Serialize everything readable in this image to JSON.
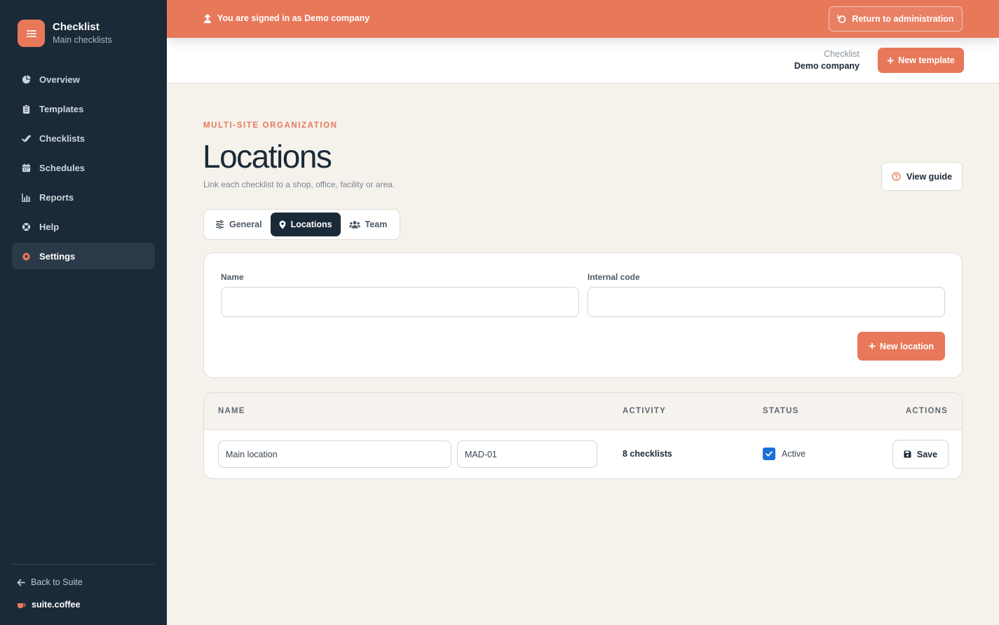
{
  "sidebar": {
    "brand_title": "Checklist",
    "brand_subtitle": "Main checklists",
    "items": [
      {
        "label": "Overview",
        "icon": "pie-chart-icon"
      },
      {
        "label": "Templates",
        "icon": "clipboard-icon"
      },
      {
        "label": "Checklists",
        "icon": "double-check-icon"
      },
      {
        "label": "Schedules",
        "icon": "calendar-icon"
      },
      {
        "label": "Reports",
        "icon": "bar-chart-icon"
      },
      {
        "label": "Help",
        "icon": "lifebuoy-icon"
      },
      {
        "label": "Settings",
        "icon": "gear-icon",
        "active": true
      }
    ],
    "back_label": "Back to Suite",
    "suite_brand": "suite.coffee"
  },
  "banner": {
    "message": "You are signed in as Demo company",
    "return_label": "Return to administration"
  },
  "topbar": {
    "company_label": "Checklist",
    "company_name": "Demo company",
    "new_template_label": "New template"
  },
  "page": {
    "eyebrow": "MULTI-SITE ORGANIZATION",
    "title": "Locations",
    "description": "Link each checklist to a shop, office, facility or area.",
    "view_guide_label": "View guide"
  },
  "tabs": [
    {
      "label": "General",
      "icon": "sliders-icon"
    },
    {
      "label": "Locations",
      "icon": "map-pin-icon",
      "active": true
    },
    {
      "label": "Team",
      "icon": "users-icon"
    }
  ],
  "form": {
    "name_label": "Name",
    "name_value": "",
    "code_label": "Internal code",
    "code_value": "",
    "new_location_label": "New location"
  },
  "table": {
    "headers": {
      "name": "NAME",
      "activity": "ACTIVITY",
      "status": "STATUS",
      "actions": "ACTIONS"
    },
    "rows": [
      {
        "name": "Main location",
        "code": "MAD-01",
        "activity": "8 checklists",
        "status_label": "Active",
        "active": true,
        "action_label": "Save"
      }
    ]
  },
  "colors": {
    "accent": "#e8785a",
    "sidebar_bg": "#1b2a38",
    "page_bg": "#f5f2ec",
    "checkbox": "#1b6fd6"
  }
}
